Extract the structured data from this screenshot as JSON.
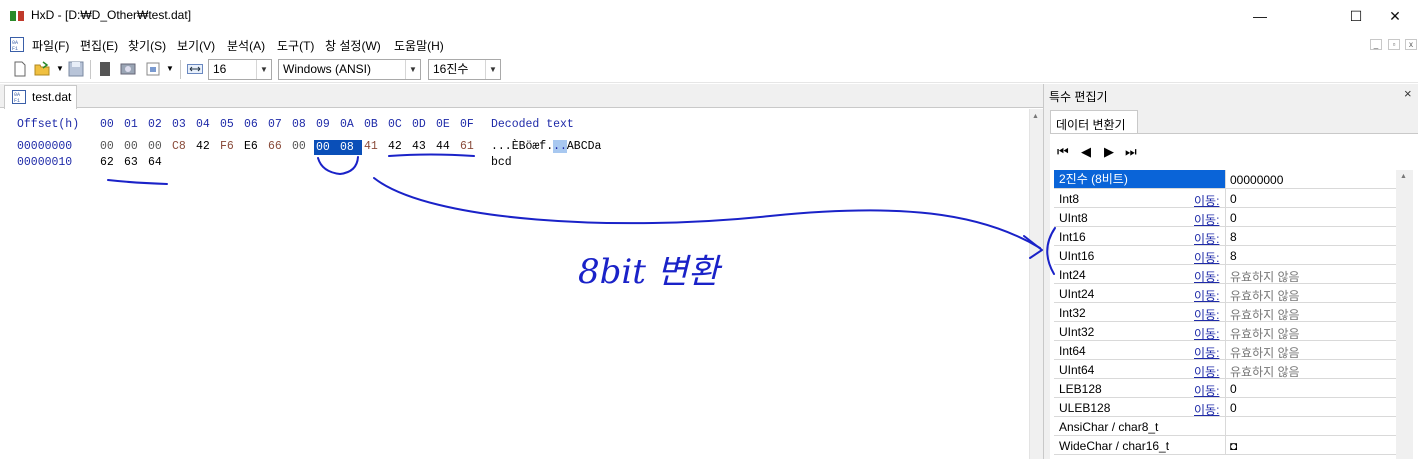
{
  "window": {
    "title": "HxD - [D:₩D_Other₩test.dat]",
    "minimize": "—",
    "maximize": "☐",
    "close": "✕"
  },
  "menu": [
    "파일(F)",
    "편집(E)",
    "찾기(S)",
    "보기(V)",
    "분석(A)",
    "도구(T)",
    "창 설정(W)",
    "도움말(H)"
  ],
  "mdi_buttons": [
    "_",
    "▫",
    "x"
  ],
  "toolbar": {
    "bytes_per_row": "16",
    "charset": "Windows (ANSI)",
    "offset_base": "16진수"
  },
  "tab": {
    "label": "test.dat"
  },
  "hex": {
    "header_offset": "Offset(h)",
    "header_cols": [
      "00",
      "01",
      "02",
      "03",
      "04",
      "05",
      "06",
      "07",
      "08",
      "09",
      "0A",
      "0B",
      "0C",
      "0D",
      "0E",
      "0F"
    ],
    "header_decoded": "Decoded text",
    "rows": [
      {
        "offset": "00000000",
        "bytes": [
          "00",
          "00",
          "00",
          "C8",
          "42",
          "F6",
          "E6",
          "66",
          "00",
          "00",
          "08",
          "41",
          "42",
          "43",
          "44",
          "61"
        ],
        "text_a": "...ÈBöæf.",
        "text_sel": "..",
        "text_b": "ABCDa"
      },
      {
        "offset": "00000010",
        "bytes": [
          "62",
          "63",
          "64"
        ],
        "text_a": "bcd",
        "text_sel": "",
        "text_b": ""
      }
    ]
  },
  "panel": {
    "title": "특수 편집기",
    "close": "×",
    "tab": "데이터 변환기",
    "nav": [
      "⏮",
      "◀",
      "▶",
      "⏭"
    ],
    "rows": [
      {
        "name": "2진수 (8비트)",
        "jump": "",
        "value": "00000000",
        "invalid": false
      },
      {
        "name": "Int8",
        "jump": "이동:",
        "value": "0",
        "invalid": false
      },
      {
        "name": "UInt8",
        "jump": "이동:",
        "value": "0",
        "invalid": false
      },
      {
        "name": "Int16",
        "jump": "이동:",
        "value": "8",
        "invalid": false
      },
      {
        "name": "UInt16",
        "jump": "이동:",
        "value": "8",
        "invalid": false
      },
      {
        "name": "Int24",
        "jump": "이동:",
        "value": "유효하지 않음",
        "invalid": true
      },
      {
        "name": "UInt24",
        "jump": "이동:",
        "value": "유효하지 않음",
        "invalid": true
      },
      {
        "name": "Int32",
        "jump": "이동:",
        "value": "유효하지 않음",
        "invalid": true
      },
      {
        "name": "UInt32",
        "jump": "이동:",
        "value": "유효하지 않음",
        "invalid": true
      },
      {
        "name": "Int64",
        "jump": "이동:",
        "value": "유효하지 않음",
        "invalid": true
      },
      {
        "name": "UInt64",
        "jump": "이동:",
        "value": "유효하지 않음",
        "invalid": true
      },
      {
        "name": "LEB128",
        "jump": "이동:",
        "value": "0",
        "invalid": false
      },
      {
        "name": "ULEB128",
        "jump": "이동:",
        "value": "0",
        "invalid": false
      },
      {
        "name": "AnsiChar / char8_t",
        "jump": "",
        "value": "",
        "invalid": false
      },
      {
        "name": "WideChar / char16_t",
        "jump": "",
        "value": "◘",
        "invalid": false
      }
    ]
  },
  "annotation": {
    "handwriting": "8bit 변환",
    "ink_color": "#1a22c8"
  },
  "colors": {
    "selection": "#0a4fb8",
    "header_blue": "#1e2aa8"
  }
}
